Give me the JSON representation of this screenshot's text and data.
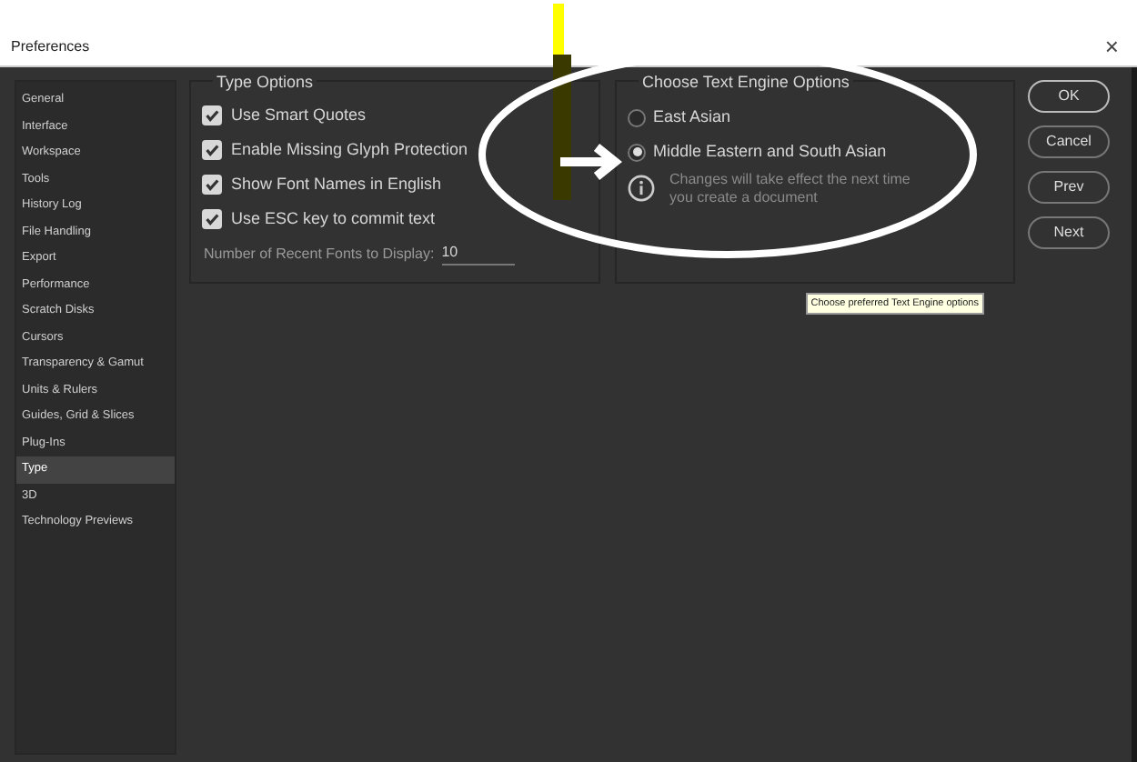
{
  "window": {
    "title": "Preferences",
    "close": "×"
  },
  "sidebar": {
    "items": [
      {
        "label": "General",
        "selected": false
      },
      {
        "label": "Interface",
        "selected": false
      },
      {
        "label": "Workspace",
        "selected": false
      },
      {
        "label": "Tools",
        "selected": false
      },
      {
        "label": "History Log",
        "selected": false
      },
      {
        "label": "File Handling",
        "selected": false
      },
      {
        "label": "Export",
        "selected": false
      },
      {
        "label": "Performance",
        "selected": false
      },
      {
        "label": "Scratch Disks",
        "selected": false
      },
      {
        "label": "Cursors",
        "selected": false
      },
      {
        "label": "Transparency & Gamut",
        "selected": false
      },
      {
        "label": "Units & Rulers",
        "selected": false
      },
      {
        "label": "Guides, Grid & Slices",
        "selected": false
      },
      {
        "label": "Plug-Ins",
        "selected": false
      },
      {
        "label": "Type",
        "selected": true
      },
      {
        "label": "3D",
        "selected": false
      },
      {
        "label": "Technology Previews",
        "selected": false
      }
    ]
  },
  "type_options": {
    "title": "Type Options",
    "checkboxes": [
      {
        "label": "Use Smart Quotes",
        "checked": true
      },
      {
        "label": "Enable Missing Glyph Protection",
        "checked": true
      },
      {
        "label": "Show Font Names in English",
        "checked": true
      },
      {
        "label": "Use ESC key to commit text",
        "checked": true
      }
    ],
    "recent_fonts": {
      "label": "Number of Recent Fonts to Display:",
      "value": "10"
    }
  },
  "text_engine": {
    "title": "Choose Text Engine Options",
    "options": [
      {
        "label": "East Asian",
        "selected": false
      },
      {
        "label": "Middle Eastern and South Asian",
        "selected": true
      }
    ],
    "note": "Changes will take effect the next time you create a document"
  },
  "buttons": [
    "OK",
    "Cancel",
    "Prev",
    "Next"
  ],
  "tooltip": "Choose preferred Text Engine options"
}
